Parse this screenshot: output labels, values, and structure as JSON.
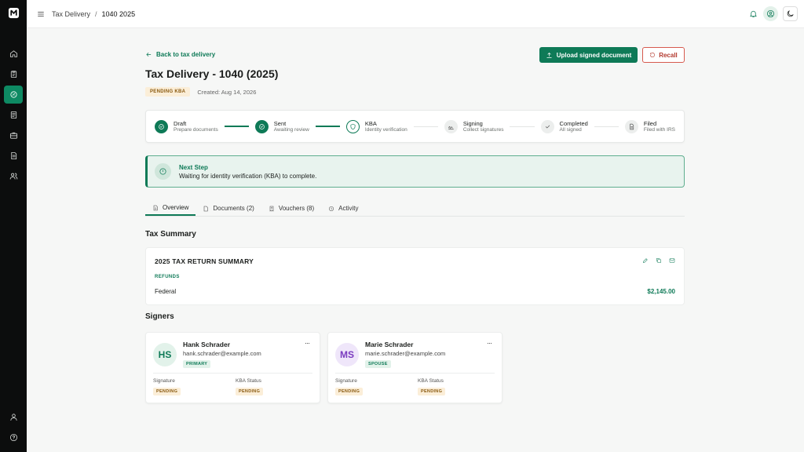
{
  "topbar": {
    "breadcrumb": [
      "Tax Delivery",
      "1040 2025"
    ],
    "separator": "/"
  },
  "sidebar": {
    "items": [
      {
        "icon": "home-icon"
      },
      {
        "icon": "clipboard-icon"
      },
      {
        "icon": "tax-delivery-icon",
        "active": true
      },
      {
        "icon": "document-icon"
      },
      {
        "icon": "briefcase-icon"
      },
      {
        "icon": "file-text-icon"
      },
      {
        "icon": "users-icon"
      }
    ],
    "bottom": [
      {
        "icon": "user-icon"
      },
      {
        "icon": "help-icon"
      }
    ]
  },
  "page": {
    "back_label": "Back to tax delivery",
    "upload_label": "Upload signed document",
    "recall_label": "Recall",
    "title": "Tax Delivery - 1040 (2025)",
    "status": "PENDING KBA",
    "created": "Created: Aug 14, 2026"
  },
  "stepper": [
    {
      "label": "Draft",
      "sub": "Prepare documents",
      "state": "done"
    },
    {
      "label": "Sent",
      "sub": "Awaiting review",
      "state": "done"
    },
    {
      "label": "KBA",
      "sub": "Identity verification",
      "state": "current"
    },
    {
      "label": "Signing",
      "sub": "Collect signatures",
      "state": "todo"
    },
    {
      "label": "Completed",
      "sub": "All signed",
      "state": "todo"
    },
    {
      "label": "Filed",
      "sub": "Filed with IRS",
      "state": "todo"
    }
  ],
  "next_step": {
    "title": "Next Step",
    "text": "Waiting for identity verification (KBA) to complete."
  },
  "tabs": [
    "Overview",
    "Documents (2)",
    "Vouchers (8)",
    "Activity"
  ],
  "tax_summary": {
    "section_title": "Tax Summary",
    "card_title": "2025 TAX RETURN SUMMARY",
    "refunds_label": "REFUNDS",
    "federal_label": "Federal",
    "federal_value": "$2,145.00"
  },
  "signers": {
    "section_title": "Signers",
    "list": [
      {
        "initials": "HS",
        "name": "Hank Schrader",
        "email": "hank.schrader@example.com",
        "role": "PRIMARY",
        "signature_label": "Signature",
        "signature_status": "PENDING",
        "kba_label": "KBA Status",
        "kba_status": "PENDING",
        "more": "···"
      },
      {
        "initials": "MS",
        "name": "Marie Schrader",
        "email": "marie.schrader@example.com",
        "role": "SPOUSE",
        "signature_label": "Signature",
        "signature_status": "PENDING",
        "kba_label": "KBA Status",
        "kba_status": "PENDING",
        "more": "···"
      }
    ]
  },
  "colors": {
    "accent": "#0e7a57",
    "danger": "#b3392e",
    "pending_bg": "#fbeed8"
  }
}
